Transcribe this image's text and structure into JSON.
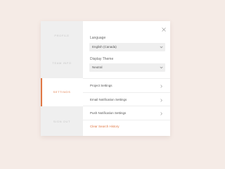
{
  "sidebar": {
    "items": [
      {
        "label": "PROFILE"
      },
      {
        "label": "TEAM INFO"
      },
      {
        "label": "SETTINGS"
      },
      {
        "label": "SIGN OUT"
      }
    ],
    "active": "SETTINGS"
  },
  "settings": {
    "language": {
      "label": "Language",
      "value": "English (Canada)"
    },
    "theme": {
      "label": "Display Theme",
      "value": "Neutral"
    },
    "rows": [
      {
        "label": "Project Settings"
      },
      {
        "label": "Email Notification Settings"
      },
      {
        "label": "Push Notification Settings"
      }
    ],
    "clear_link": "Clear Search History"
  },
  "colors": {
    "accent": "#e07845",
    "background": "#f5ebe6",
    "sidebar": "#efefef",
    "panel": "#ffffff"
  },
  "icons": {
    "close": "close-icon",
    "dropdown": "chevron-down-icon",
    "row": "chevron-right-icon"
  }
}
